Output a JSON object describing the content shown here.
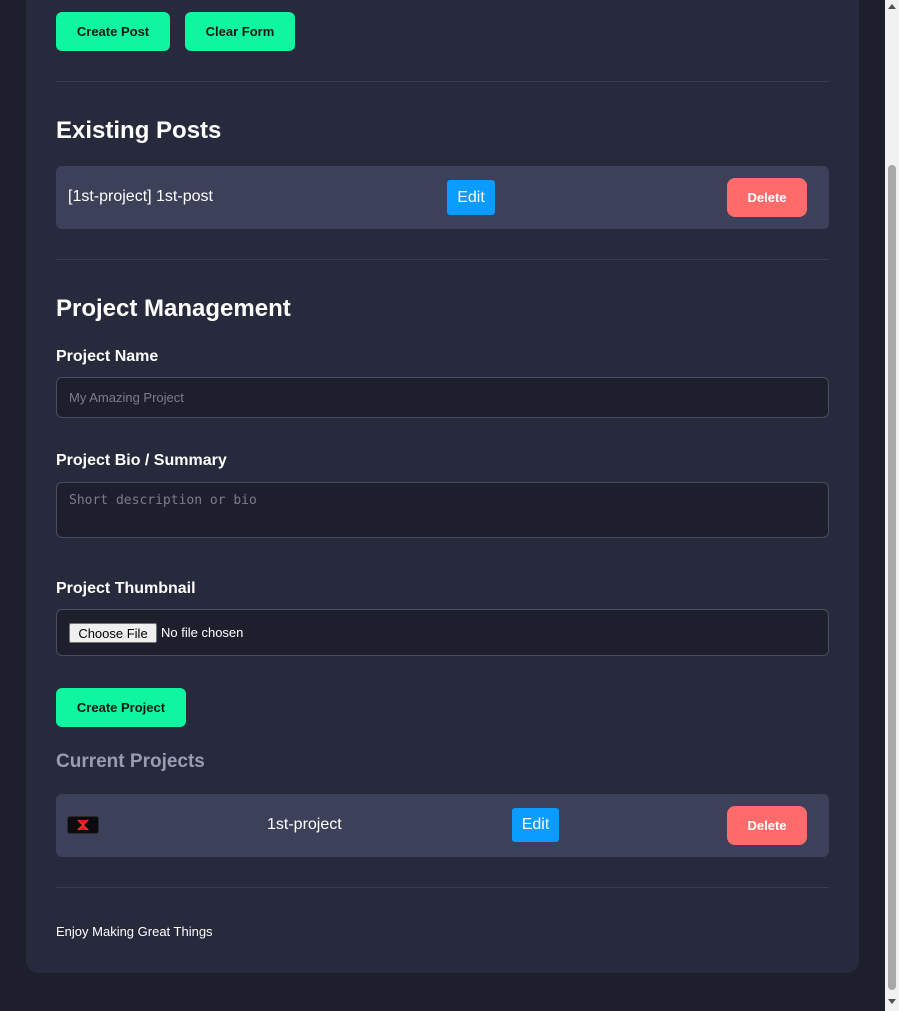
{
  "post_form": {
    "create_label": "Create Post",
    "clear_label": "Clear Form"
  },
  "existing_posts": {
    "heading": "Existing Posts",
    "items": [
      {
        "title": "[1st-project] 1st-post",
        "edit_label": "Edit",
        "delete_label": "Delete"
      }
    ]
  },
  "project_management": {
    "heading": "Project Management",
    "name_label": "Project Name",
    "name_placeholder": "My Amazing Project",
    "bio_label": "Project Bio / Summary",
    "bio_placeholder": "Short description or bio",
    "thumbnail_label": "Project Thumbnail",
    "file_button": "Choose File",
    "file_status": "No file chosen",
    "create_label": "Create Project"
  },
  "current_projects": {
    "heading": "Current Projects",
    "items": [
      {
        "thumbnail_icon": "project-thumbnail-x-icon",
        "name": "1st-project",
        "edit_label": "Edit",
        "delete_label": "Delete"
      }
    ]
  },
  "footer": {
    "text": "Enjoy Making Great Things"
  },
  "colors": {
    "accent_green": "#10f5a0",
    "edit_blue": "#0a9dff",
    "delete_red": "#ff6b6b",
    "panel_bg": "#272a3c",
    "page_bg": "#1e1f2c"
  }
}
